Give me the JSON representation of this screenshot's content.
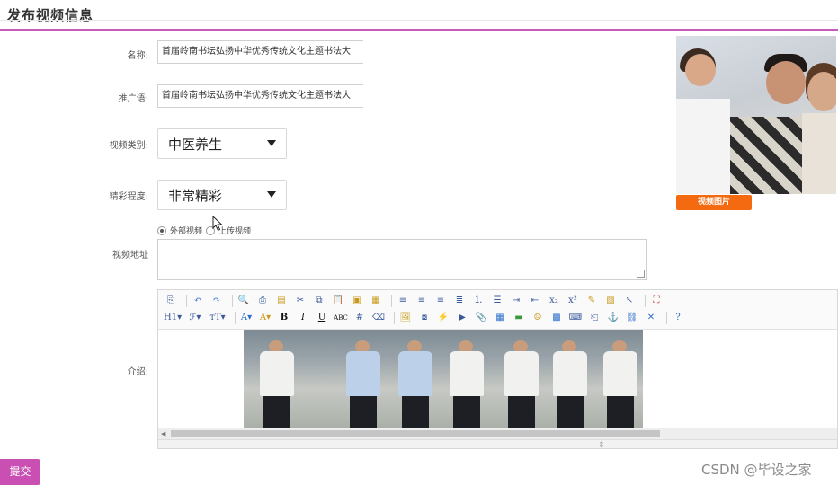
{
  "header": {
    "title": "发布视频信息"
  },
  "form": {
    "name_label": "名称:",
    "name_value": "首届岭南书坛弘扬中华优秀传统文化主题书法大",
    "promo_label": "推广语:",
    "promo_value": "首届岭南书坛弘扬中华优秀传统文化主题书法大",
    "category_label": "视频类别:",
    "category_value": "中医养生",
    "quality_label": "精彩程度:",
    "quality_value": "非常精彩",
    "source_options": [
      {
        "label": "外部视频",
        "checked": true
      },
      {
        "label": "上传视频",
        "checked": false
      }
    ],
    "url_label": "视频地址",
    "intro_label": "介绍:"
  },
  "thumbnail": {
    "badge": "视频图片"
  },
  "editor": {
    "toolbar_row1": [
      "source-icon",
      "undo-icon",
      "redo-icon",
      "preview-icon",
      "print-icon",
      "template-icon",
      "cut-icon",
      "copy-icon",
      "paste-icon",
      "paste-text-icon",
      "paste-word-icon",
      "align-left-icon",
      "align-center-icon",
      "align-right-icon",
      "align-justify-icon",
      "ordered-list-icon",
      "unordered-list-icon",
      "indent-icon",
      "outdent-icon",
      "subscript-icon",
      "superscript-icon",
      "clear-format-icon",
      "select-all-icon",
      "pointer-icon",
      "fullscreen-icon"
    ],
    "toolbar_row2": [
      "heading-icon",
      "font-family-icon",
      "font-size-icon",
      "font-color-icon",
      "highlight-icon",
      "bold-icon",
      "italic-icon",
      "underline-icon",
      "strikethrough-icon",
      "line-height-icon",
      "remove-format-icon",
      "image-icon",
      "multi-image-icon",
      "flash-icon",
      "media-icon",
      "attachment-icon",
      "table-icon",
      "insert-hr-icon",
      "emoticon-icon",
      "map-icon",
      "code-icon",
      "pagebreak-icon",
      "anchor-icon",
      "link-icon",
      "unlink-icon",
      "help-icon"
    ]
  },
  "actions": {
    "submit_label": "提交"
  },
  "watermark": "CSDN @毕设之家",
  "colors": {
    "accent": "#c94fb3",
    "badge": "#f36a10"
  }
}
